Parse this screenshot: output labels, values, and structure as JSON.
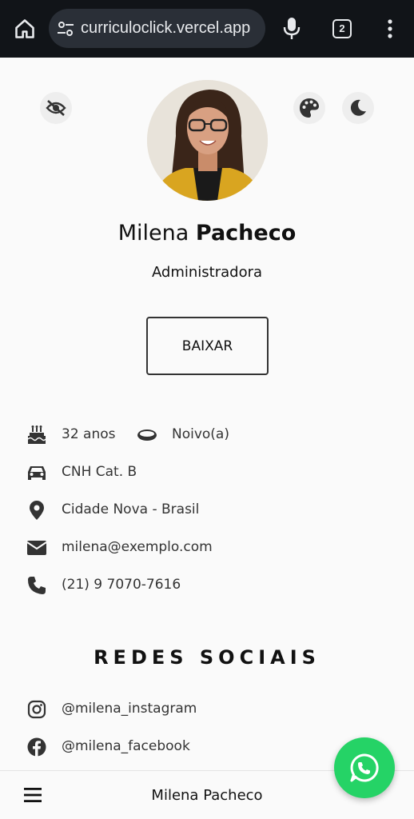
{
  "browser": {
    "url": "curriculoclick.vercel.app",
    "tab_count": "2"
  },
  "profile": {
    "first_name": "Milena",
    "last_name": "Pacheco",
    "role": "Administradora",
    "download_label": "BAIXAR"
  },
  "info": {
    "age": "32 anos",
    "marital": "Noivo(a)",
    "license": "CNH Cat. B",
    "location": "Cidade Nova - Brasil",
    "email": "milena@exemplo.com",
    "phone": "(21) 9 7070-7616"
  },
  "social": {
    "title": "REDES SOCIAIS",
    "instagram": "@milena_instagram",
    "facebook": "@milena_facebook"
  },
  "bottom_bar": {
    "name": "Milena Pacheco"
  },
  "icons": {
    "home": "home-icon",
    "site_settings": "tune-icon",
    "mic": "mic-icon",
    "tabs": "tabs-icon",
    "menu": "more-vert-icon",
    "hide": "eye-slash-icon",
    "palette": "palette-icon",
    "theme": "moon-icon",
    "age": "birthday-cake-icon",
    "marital": "ring-icon",
    "license": "car-icon",
    "location": "location-pin-icon",
    "email": "envelope-icon",
    "phone": "phone-icon",
    "instagram": "instagram-icon",
    "facebook": "facebook-icon",
    "whatsapp": "whatsapp-icon",
    "hamburger": "hamburger-icon"
  },
  "colors": {
    "browser_bar": "#111418",
    "url_pill": "#2a2f37",
    "page_bg": "#fafafa",
    "whatsapp": "#25d366",
    "avatar_jacket": "#d9a520"
  }
}
